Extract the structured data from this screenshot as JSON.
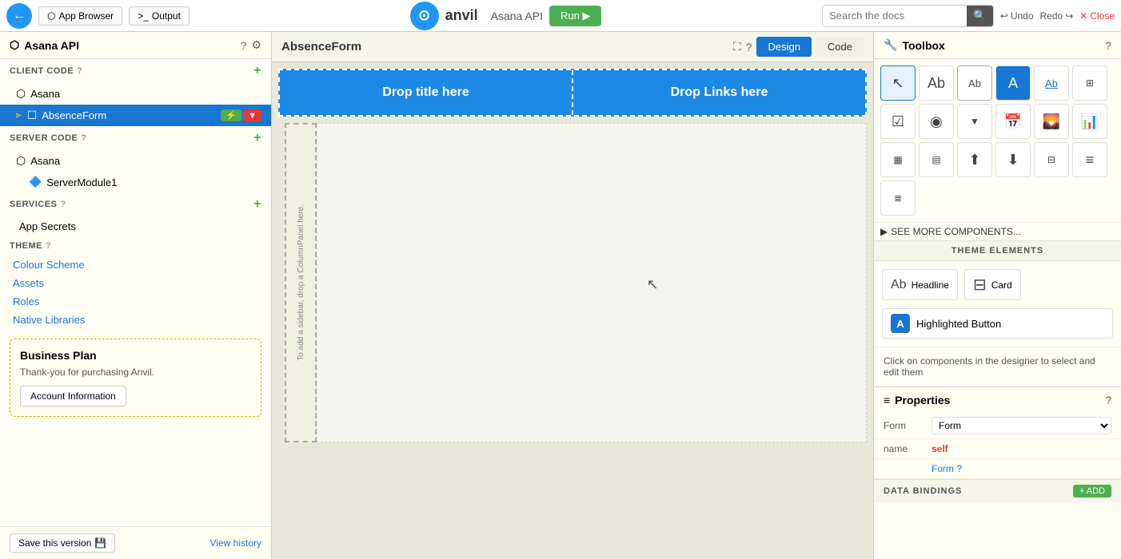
{
  "topbar": {
    "logo_char": "←",
    "app_browser_label": "App Browser",
    "output_label": "Output",
    "brand_name": "anvil",
    "app_name": "Asana API",
    "run_label": "Run ▶",
    "search_placeholder": "Search the docs",
    "undo_label": "Undo",
    "redo_label": "Redo",
    "close_label": "Close"
  },
  "left_panel": {
    "header_title": "Asana API",
    "client_code_label": "CLIENT CODE",
    "server_code_label": "SERVER CODE",
    "services_label": "SERVICES",
    "theme_label": "THEME",
    "client_items": [
      {
        "label": "Asana",
        "type": "module"
      },
      {
        "label": "AbsenceForm",
        "type": "form",
        "active": true
      }
    ],
    "server_items": [
      {
        "label": "Asana",
        "type": "module"
      },
      {
        "label": "ServerModule1",
        "type": "server_module"
      }
    ],
    "service_items": [
      {
        "label": "App Secrets"
      }
    ],
    "theme_items": [
      {
        "label": "Colour Scheme"
      },
      {
        "label": "Assets"
      },
      {
        "label": "Roles"
      },
      {
        "label": "Native Libraries"
      }
    ],
    "business_plan": {
      "title": "Business Plan",
      "text": "Thank-you for purchasing Anvil.",
      "button_label": "Account Information"
    },
    "save_button_label": "Save this version",
    "view_history_label": "View history"
  },
  "center_panel": {
    "form_title": "AbsenceForm",
    "design_tab_label": "Design",
    "code_tab_label": "Code",
    "drop_title_label": "Drop title here",
    "drop_links_label": "Drop Links here",
    "sidebar_drop_text": "To add a sidebar, drop a ColumnPanel here."
  },
  "right_panel": {
    "toolbox_title": "Toolbox",
    "tools": [
      {
        "name": "cursor",
        "symbol": "↖"
      },
      {
        "name": "text-label",
        "symbol": "Ab"
      },
      {
        "name": "text-box",
        "symbol": "Ab"
      },
      {
        "name": "big-a",
        "symbol": "A"
      },
      {
        "name": "small-text",
        "symbol": "Ab"
      },
      {
        "name": "table-icon",
        "symbol": "⊞"
      },
      {
        "name": "checkbox",
        "symbol": "☑"
      },
      {
        "name": "radio",
        "symbol": "◉"
      },
      {
        "name": "dropdown",
        "symbol": "▼"
      },
      {
        "name": "calendar",
        "symbol": "📅"
      },
      {
        "name": "image",
        "symbol": "🖼"
      },
      {
        "name": "chart",
        "symbol": "📊"
      },
      {
        "name": "grid",
        "symbol": "▦"
      },
      {
        "name": "columns",
        "symbol": "▤"
      },
      {
        "name": "upload",
        "symbol": "⬆"
      },
      {
        "name": "form-layout",
        "symbol": "⬇"
      },
      {
        "name": "split-panel",
        "symbol": "⊟"
      },
      {
        "name": "list",
        "symbol": "≡"
      },
      {
        "name": "list2",
        "symbol": "≣"
      }
    ],
    "see_more_label": "SEE MORE COMPONENTS...",
    "theme_elements_label": "THEME ELEMENTS",
    "theme_elements": [
      {
        "name": "headline",
        "icon": "Ab",
        "label": "Headline"
      },
      {
        "name": "card",
        "icon": "⊞",
        "label": "Card"
      }
    ],
    "highlighted_button_label": "Highlighted Button",
    "click_hint": "Click on components in the designer to select and edit them",
    "properties_title": "Properties",
    "prop_form_label": "Form",
    "prop_name_label": "name",
    "prop_name_value": "self",
    "prop_form_link": "Form",
    "data_bindings_label": "DATA BINDINGS",
    "add_label": "+ ADD"
  }
}
